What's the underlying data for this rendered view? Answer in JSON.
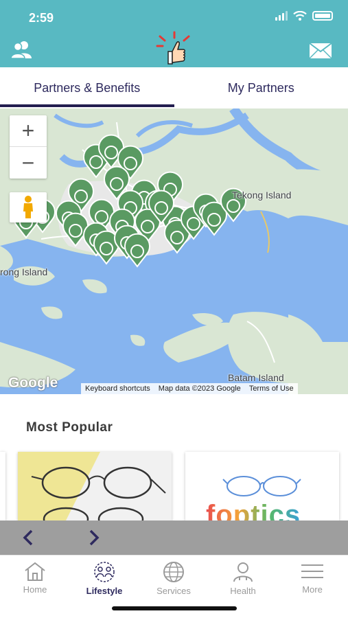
{
  "status": {
    "time": "2:59"
  },
  "header": {
    "left_icon": "users-icon",
    "logo_icon": "thumbs-up-logo",
    "right_icon": "mail-icon"
  },
  "tabs": [
    {
      "label": "Partners & Benefits",
      "active": true
    },
    {
      "label": "My Partners",
      "active": false
    }
  ],
  "map": {
    "labels": {
      "tekong": "Tekong Island",
      "jurong": "rong Island",
      "batam": "Batam Island"
    },
    "zoom_in": "+",
    "zoom_out": "−",
    "google": "Google",
    "attribution": {
      "shortcuts": "Keyboard shortcuts",
      "data": "Map data ©2023 Google",
      "terms": "Terms of Use"
    },
    "marker_color": "#5a9a62"
  },
  "most_popular": {
    "title": "Most Popular",
    "card2_text": "foptics"
  },
  "carousel": {
    "prev_icon": "chevron-left-icon",
    "next_icon": "chevron-right-icon"
  },
  "bottom_nav": [
    {
      "label": "Home",
      "icon": "home-icon",
      "active": false
    },
    {
      "label": "Lifestyle",
      "icon": "lifestyle-icon",
      "active": true
    },
    {
      "label": "Services",
      "icon": "globe-icon",
      "active": false
    },
    {
      "label": "Health",
      "icon": "doctor-icon",
      "active": false
    },
    {
      "label": "More",
      "icon": "menu-icon",
      "active": false
    }
  ],
  "colors": {
    "header": "#58b9c2",
    "accent": "#231e4f",
    "water": "#86b4ef",
    "land": "#d9e6d3"
  }
}
